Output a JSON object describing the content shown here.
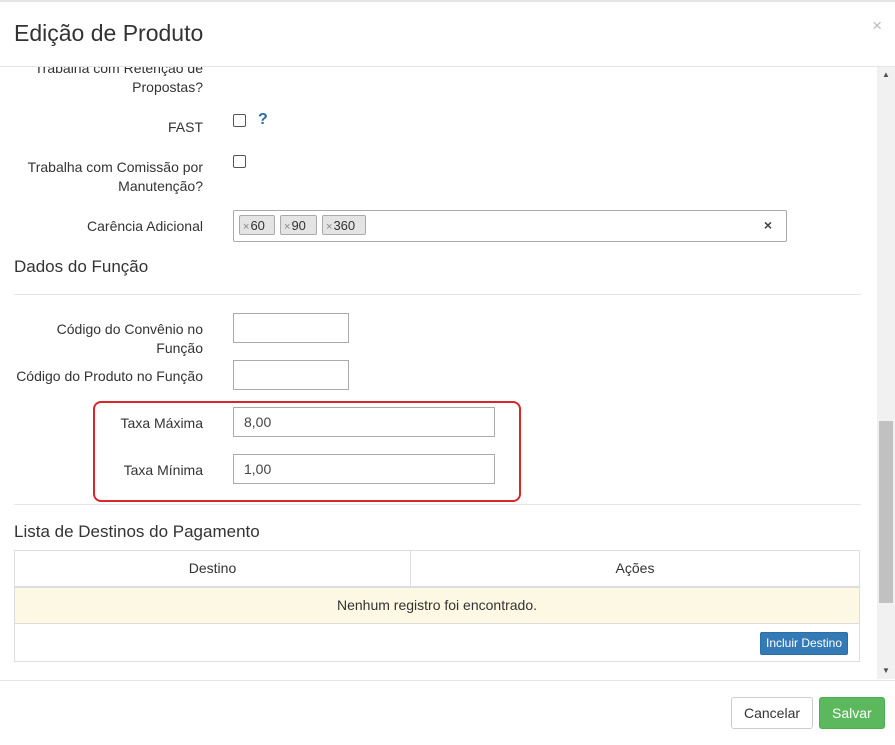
{
  "modal": {
    "title": "Edição de Produto",
    "close_label": "×"
  },
  "form": {
    "retencao_label_line1": "Trabalha com Retenção de",
    "retencao_label_line2": "Propostas?",
    "fast_label": "FAST",
    "help_label": "?",
    "comissao_label_line1": "Trabalha com Comissão por",
    "comissao_label_line2": "Manutenção?",
    "carencia_label": "Carência Adicional",
    "carencia_tags": [
      "60",
      "90",
      "360"
    ],
    "tag_remove": "×",
    "tag_clear": "×"
  },
  "funcao_section": {
    "title": "Dados do Função",
    "codigo_convenio_label": "Código do Convênio no Função",
    "codigo_convenio_value": "",
    "codigo_produto_label": "Código do Produto no Função",
    "codigo_produto_value": "",
    "taxa_maxima_label": "Taxa Máxima",
    "taxa_maxima_value": "8,00",
    "taxa_minima_label": "Taxa Mínima",
    "taxa_minima_value": "1,00"
  },
  "destinos_section": {
    "title": "Lista de Destinos do Pagamento",
    "columns": [
      "Destino",
      "Ações"
    ],
    "empty_message": "Nenhum registro foi encontrado.",
    "add_button": "Incluir Destino"
  },
  "footer": {
    "cancel_label": "Cancelar",
    "save_label": "Salvar"
  },
  "scrollbar": {
    "up_glyph": "▲",
    "down_glyph": "▼"
  },
  "colors": {
    "highlight": "#d9262b",
    "primary": "#337ab7",
    "success": "#5cb85c",
    "warning_row": "#fcf8e3"
  }
}
